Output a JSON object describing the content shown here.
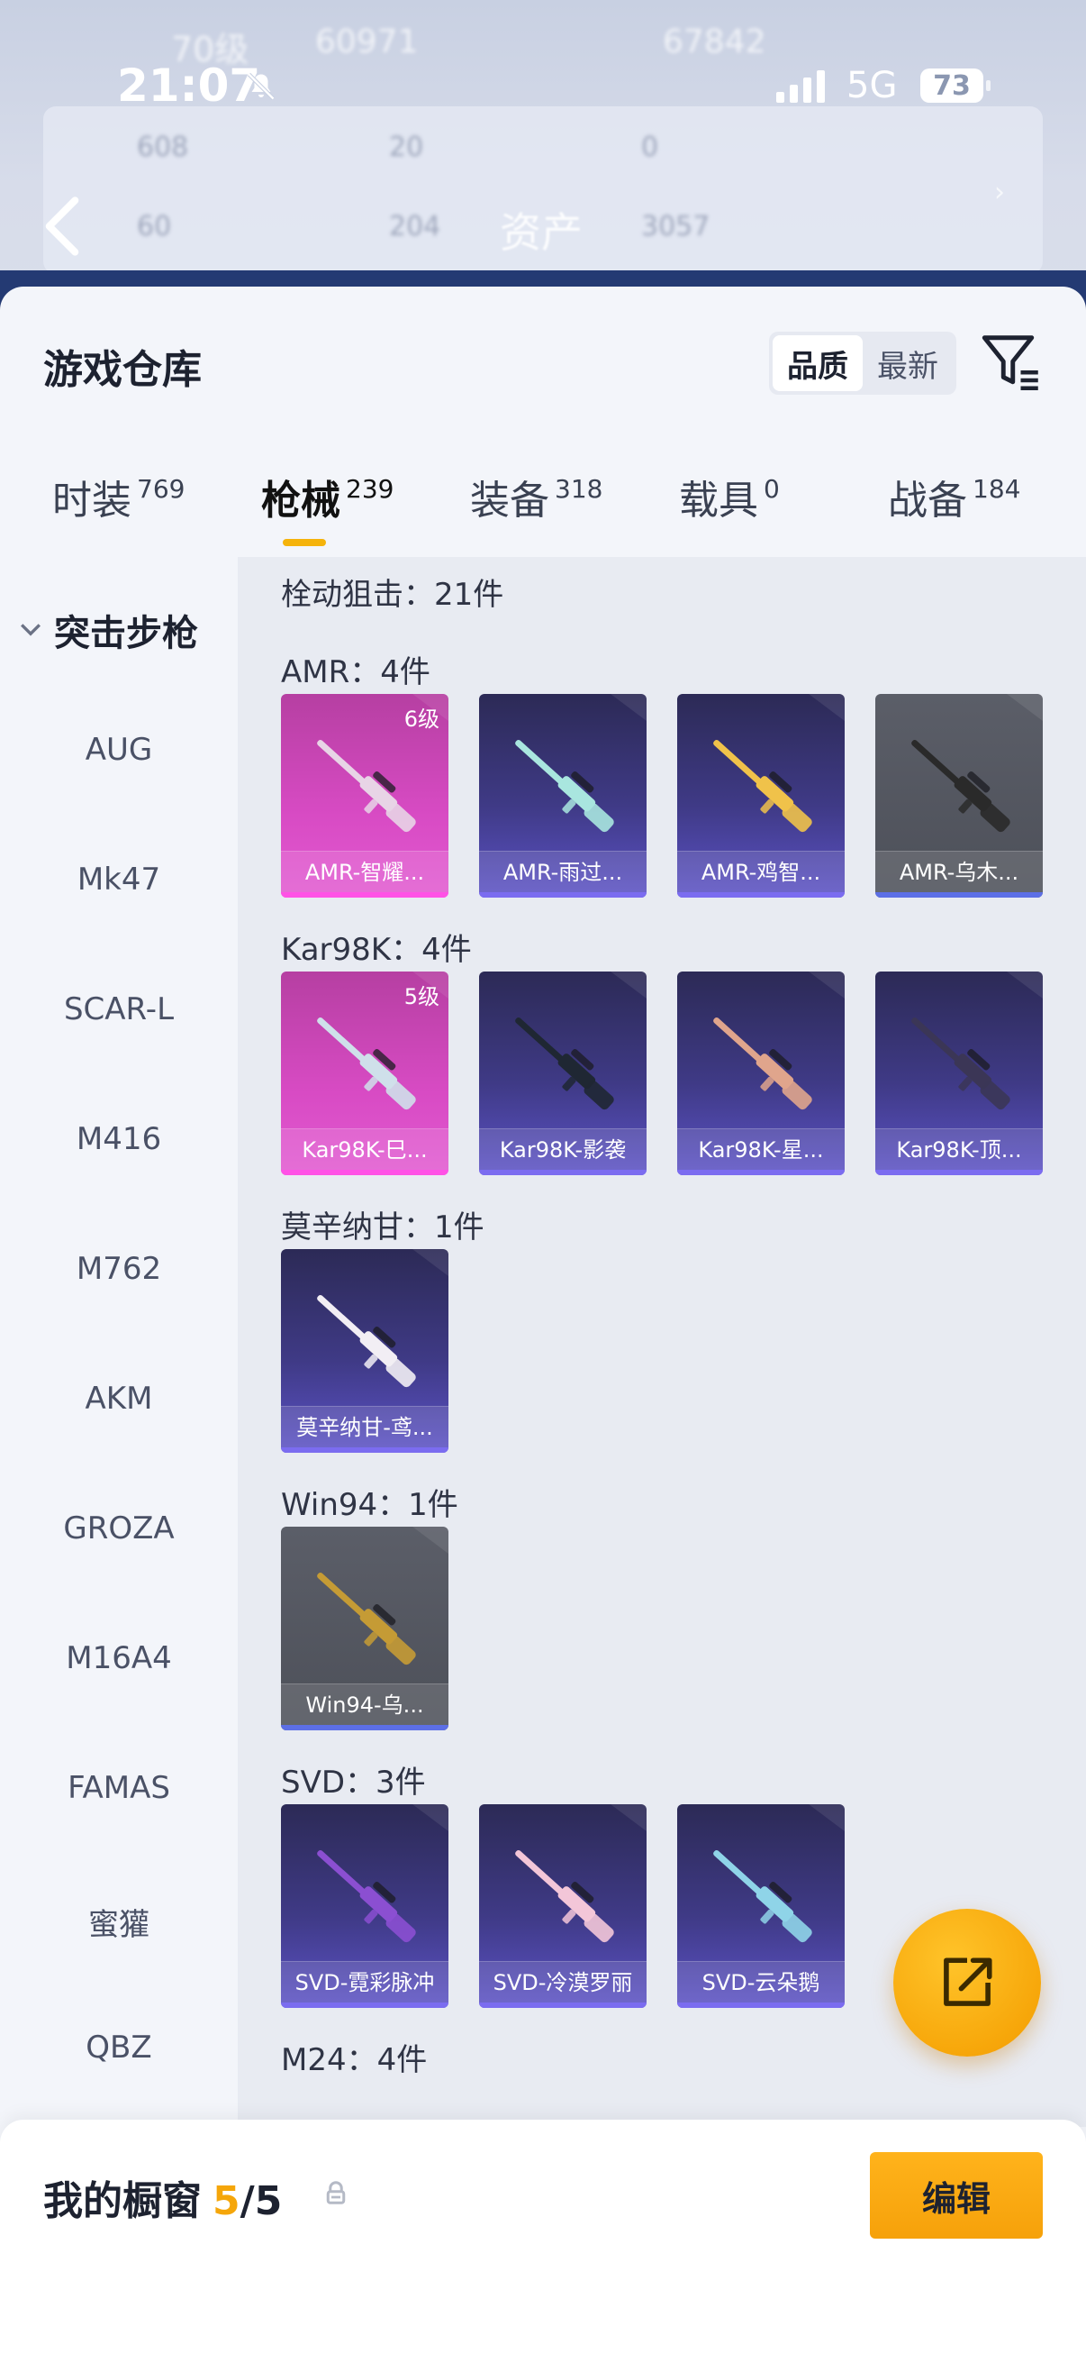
{
  "status_bar": {
    "time": "21:07",
    "network": "5G",
    "battery": "73",
    "icons": [
      "mute-bell-icon",
      "signal-icon"
    ]
  },
  "background_header": {
    "title": "资产",
    "level_text": "70级",
    "stat_a": "60971",
    "stat_b": "67842",
    "row1": [
      "608",
      "20",
      "0"
    ],
    "row2": [
      "60",
      "204",
      "3057"
    ]
  },
  "sheet": {
    "title": "游戏仓库",
    "sort_options": [
      "品质",
      "最新"
    ],
    "sort_selected": "品质"
  },
  "tabs": [
    {
      "label": "时装",
      "count": "769",
      "active": false
    },
    {
      "label": "枪械",
      "count": "239",
      "active": true
    },
    {
      "label": "装备",
      "count": "318",
      "active": false
    },
    {
      "label": "载具",
      "count": "0",
      "active": false
    },
    {
      "label": "战备",
      "count": "184",
      "active": false
    }
  ],
  "sidebar": {
    "group": "突击步枪",
    "items": [
      "AUG",
      "Mk47",
      "SCAR-L",
      "M416",
      "M762",
      "AKM",
      "GROZA",
      "M16A4",
      "FAMAS",
      "蜜獾",
      "QBZ"
    ]
  },
  "content": {
    "category_summary": "栓动狙击：21件",
    "sections": [
      {
        "header": "AMR：4件",
        "items": [
          {
            "name": "AMR-智耀...",
            "rarity": "pink",
            "badge": "6级",
            "gun_color": "#e8d4e6"
          },
          {
            "name": "AMR-雨过...",
            "rarity": "purple",
            "badge": "",
            "gun_color": "#a9e6df"
          },
          {
            "name": "AMR-鸡智...",
            "rarity": "purple",
            "badge": "",
            "gun_color": "#f0c24a"
          },
          {
            "name": "AMR-乌木...",
            "rarity": "grey",
            "badge": "",
            "gun_color": "#2a2a2a"
          }
        ]
      },
      {
        "header": "Kar98K：4件",
        "items": [
          {
            "name": "Kar98K-巳...",
            "rarity": "pink",
            "badge": "5级",
            "gun_color": "#cfe0ea"
          },
          {
            "name": "Kar98K-影袭",
            "rarity": "purple",
            "badge": "",
            "gun_color": "#1f2733"
          },
          {
            "name": "Kar98K-星...",
            "rarity": "purple",
            "badge": "",
            "gun_color": "#e0a58c"
          },
          {
            "name": "Kar98K-顶...",
            "rarity": "purple",
            "badge": "",
            "gun_color": "#3b3656"
          }
        ]
      },
      {
        "header": "莫辛纳甘：1件",
        "items": [
          {
            "name": "莫辛纳甘-鸢...",
            "rarity": "purple",
            "badge": "",
            "gun_color": "#f2eef4"
          }
        ]
      },
      {
        "header": "Win94：1件",
        "items": [
          {
            "name": "Win94-乌...",
            "rarity": "grey",
            "badge": "",
            "gun_color": "#c59b35"
          }
        ]
      },
      {
        "header": "SVD：3件",
        "items": [
          {
            "name": "SVD-霓彩脉冲",
            "rarity": "purple",
            "badge": "",
            "gun_color": "#8b4fd1"
          },
          {
            "name": "SVD-冷漠罗丽",
            "rarity": "purple",
            "badge": "",
            "gun_color": "#f3c6d8"
          },
          {
            "name": "SVD-云朵鹅",
            "rarity": "purple",
            "badge": "",
            "gun_color": "#8fd4e8"
          }
        ]
      },
      {
        "header": "M24：4件",
        "items": []
      }
    ]
  },
  "fab": {
    "icon": "share-external-icon"
  },
  "bottom_panel": {
    "title": "我的橱窗",
    "current": "5",
    "separator": "/",
    "total": "5",
    "edit_label": "编辑"
  },
  "colors": {
    "accent": "#f5a60a",
    "rarity_pink": "#d84bc4",
    "rarity_purple": "#3f3a86",
    "rarity_grey": "#5b5e68"
  }
}
